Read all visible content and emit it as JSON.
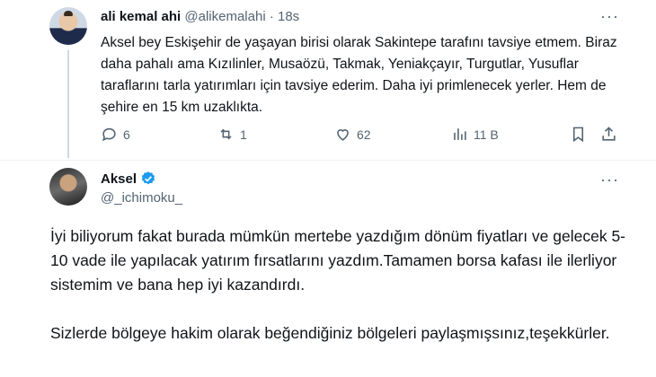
{
  "reply_tweet": {
    "author_name": "ali kemal ahi",
    "author_handle": "@alikemalahi",
    "separator": "·",
    "time": "18s",
    "text": "Aksel bey Eskişehir de yaşayan birisi olarak Sakintepe tarafını tavsiye etmem. Biraz daha pahalı ama Kızılinler, Musaözü, Takmak, Yeniakçayır, Turgutlar, Yusuflar taraflarını tarla yatırımları için tavsiye ederim. Daha iyi primlenecek yerler. Hem de şehire en 15 km uzaklıkta.",
    "replies": "6",
    "retweets": "1",
    "likes": "62",
    "views": "11 B",
    "more": "···"
  },
  "main_tweet": {
    "author_name": "Aksel",
    "author_handle": "@_ichimoku_",
    "more": "···",
    "paragraph1": "İyi biliyorum fakat burada mümkün mertebe yazdığım dönüm fiyatları ve gelecek 5-10 vade ile yapılacak yatırım fırsatlarını yazdım.Tamamen borsa kafası ile ilerliyor sistemim ve bana hep iyi kazandırdı.",
    "paragraph2": "Sizlerde bölgeye hakim olarak beğendiğiniz bölgeleri paylaşmışsınız,teşekkürler."
  },
  "colors": {
    "text": "#0f1419",
    "muted": "#536471",
    "verified": "#1d9bf0"
  },
  "icons": [
    "reply-icon",
    "retweet-icon",
    "like-icon",
    "views-icon",
    "bookmark-icon",
    "share-icon",
    "verified-badge-icon",
    "more-icon"
  ]
}
